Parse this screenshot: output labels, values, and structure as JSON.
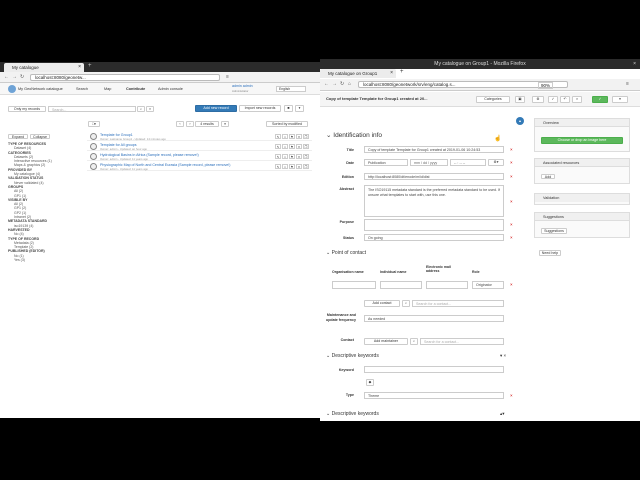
{
  "left_window": {
    "tab_title": "My catalogue",
    "url": "localhost:8080/geonetw...",
    "nav": {
      "brand": "My GeoNetwork catalogue",
      "search": "Search",
      "map": "Map",
      "contribute": "Contribute",
      "admin": "Admin console",
      "user_name": "admin admin",
      "user_sub": "Administrator",
      "language": "English"
    },
    "toolbar": {
      "only_my_records": "Only my records",
      "search_placeholder": "Search...",
      "add_new_record": "Add new record",
      "import_new_records": "Import new records"
    },
    "results_bar": {
      "count": "4 results",
      "sort": "Sorted by modified"
    },
    "facet_buttons": {
      "expand": "Expand",
      "collapse": "Collapse"
    },
    "facets": [
      {
        "heading": "TYPE OF RESOURCES",
        "items": [
          "Dataset (4)"
        ]
      },
      {
        "heading": "CATEGORIES",
        "items": [
          "Datasets (2)",
          "Interactive resources (1)",
          "Maps & graphics (2)"
        ]
      },
      {
        "heading": "PROVIDED BY",
        "items": [
          "My catalogue (4)"
        ]
      },
      {
        "heading": "VALIDATION STATUS",
        "items": [
          "Never validated (4)"
        ]
      },
      {
        "heading": "GROUPS",
        "items": [
          "All (2)",
          "GP1 (1)"
        ]
      },
      {
        "heading": "VISIBLE BY",
        "items": [
          "All (2)",
          "GP1 (2)",
          "GP2 (1)",
          "Intranet (2)"
        ]
      },
      {
        "heading": "METADATA STANDARD",
        "items": [
          "iso19139 (4)"
        ]
      },
      {
        "heading": "HARVESTED",
        "items": [
          "No (4)"
        ]
      },
      {
        "heading": "TYPE OF RECORD",
        "items": [
          "Metadata (2)",
          "Template (2)"
        ]
      },
      {
        "heading": "PUBLISHED (EDITOR)",
        "items": [
          "No (1)",
          "Yes (3)"
        ]
      }
    ],
    "results": [
      {
        "title": "Template for Group1",
        "sub": "Owner: Lastname Group1 - Updated: 14 minutes ago"
      },
      {
        "title": "Template for All groups",
        "sub": "Owner: admin - Updated: an hour ago"
      },
      {
        "title": "Hydrological Basins in Africa (Sample record, please remove!)",
        "sub": "Owner: admin - Updated: 11 years ago"
      },
      {
        "title": "Physiographic Map of North and Central Eurasia (Sample record, please remove!)",
        "sub": "Owner: admin - Updated: 11 years ago"
      }
    ]
  },
  "right_window": {
    "window_title": "My catalogue on Group1 - Mozilla Firefox",
    "tab_title": "My catalogue on Group1",
    "url": "localhost:8080/geonetwork/srv/eng/catalog.s...",
    "zoom": "90%",
    "editor": {
      "record_title": "Copy of template Template for Group1 created at 20...",
      "categories": "Categories",
      "save_label": "✓",
      "identification_heading": "Identification info",
      "title_label": "Title",
      "title_value": "Copy of template Template for Group1 created at 2019-01-06 10:24:53",
      "date_label": "Date",
      "date_type": "Publication",
      "date_placeholder": "mm / dd / yyyy",
      "time_placeholder": "-- : -- --",
      "edition_label": "Edition",
      "edition_value": "http://localhost:8080/dt/enode/m/id/dist",
      "abstract_label": "Abstract",
      "abstract_value": "The ISO19115 metadata standard is the preferred metadata standard to be used. If unsure what templates to start with, use this one.",
      "purpose_label": "Purpose",
      "status_label": "Status",
      "status_value": "On going",
      "poc_heading": "Point of contact",
      "col_org": "Organisation name",
      "col_ind": "Individual name",
      "col_email": "Electronic mail address",
      "col_role": "Role",
      "role_value": "Originator",
      "add_contact": "Add contact",
      "search_contact": "Search for a contact...",
      "maint_label": "Maintenance and update frequency",
      "maint_value": "As needed",
      "contact_label": "Contact",
      "add_maintainer": "Add maintainer",
      "search_contact2": "Search for a contact...",
      "desc_kw_heading": "Descriptive keywords",
      "keyword_label": "Keyword",
      "type_label": "Type",
      "type_value": "Theme",
      "desc_kw_heading2": "Descriptive keywords"
    },
    "sidebar": {
      "overview": "Overview",
      "choose_image": "Choose or drop an image here",
      "associated": "Associated resources",
      "add": "Add",
      "validation": "Validation",
      "suggestions": "Suggestions",
      "suggestions_btn": "Suggestions",
      "need_help": "Need help"
    }
  }
}
